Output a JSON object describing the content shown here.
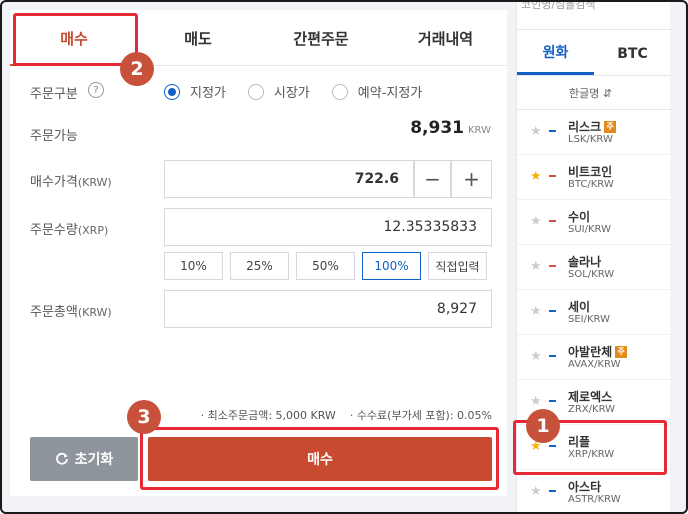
{
  "tabs": [
    "매수",
    "매도",
    "간편주문",
    "거래내역"
  ],
  "order": {
    "order_type_label": "주문구분",
    "help_symbol": "?",
    "order_types": [
      "지정가",
      "시장가",
      "예약-지정가"
    ],
    "selected_order_type": "지정가",
    "available_label": "주문가능",
    "available_value": "8,931",
    "available_unit": "KRW",
    "price_label": "매수가격",
    "price_unit": "(KRW)",
    "price_value": "722.6",
    "minus_symbol": "−",
    "plus_symbol": "+",
    "qty_label": "주문수량",
    "qty_unit": "(XRP)",
    "qty_value": "12.35335833",
    "pct_buttons": [
      "10%",
      "25%",
      "50%",
      "100%",
      "직접입력"
    ],
    "selected_pct": "100%",
    "total_label": "주문총액",
    "total_unit": "(KRW)",
    "total_value": "8,927",
    "notes": [
      "최소주문금액: 5,000 KRW",
      "수수료(부가세 포함): 0.05%"
    ],
    "reset_label": "초기화",
    "buy_label": "매수"
  },
  "market": {
    "top_text": "코인명/심볼검색",
    "tabs": [
      "원화",
      "BTC"
    ],
    "active_tab": "원화",
    "column_header": "한글명 ⇵",
    "coins": [
      {
        "name": "리스크",
        "pair": "LSK/KRW",
        "fav": false,
        "warn": true,
        "trend": "blue"
      },
      {
        "name": "비트코인",
        "pair": "BTC/KRW",
        "fav": true,
        "warn": false,
        "trend": "red"
      },
      {
        "name": "수이",
        "pair": "SUI/KRW",
        "fav": false,
        "warn": false,
        "trend": "red"
      },
      {
        "name": "솔라나",
        "pair": "SOL/KRW",
        "fav": false,
        "warn": false,
        "trend": "red"
      },
      {
        "name": "세이",
        "pair": "SEI/KRW",
        "fav": false,
        "warn": false,
        "trend": "blue"
      },
      {
        "name": "아발란체",
        "pair": "AVAX/KRW",
        "fav": false,
        "warn": true,
        "trend": "blue"
      },
      {
        "name": "제로엑스",
        "pair": "ZRX/KRW",
        "fav": false,
        "warn": false,
        "trend": "blue"
      },
      {
        "name": "리플",
        "pair": "XRP/KRW",
        "fav": true,
        "warn": false,
        "trend": "blue"
      },
      {
        "name": "아스타",
        "pair": "ASTR/KRW",
        "fav": false,
        "warn": false,
        "trend": "blue"
      }
    ],
    "warn_badge": "주"
  },
  "annotations": [
    "1",
    "2",
    "3"
  ],
  "colors": {
    "buy_red": "#c84a31",
    "accent_blue": "#1261c4",
    "highlight_red": "#e52a36",
    "badge": "#c8513c",
    "reset_gray": "#8f959d"
  }
}
